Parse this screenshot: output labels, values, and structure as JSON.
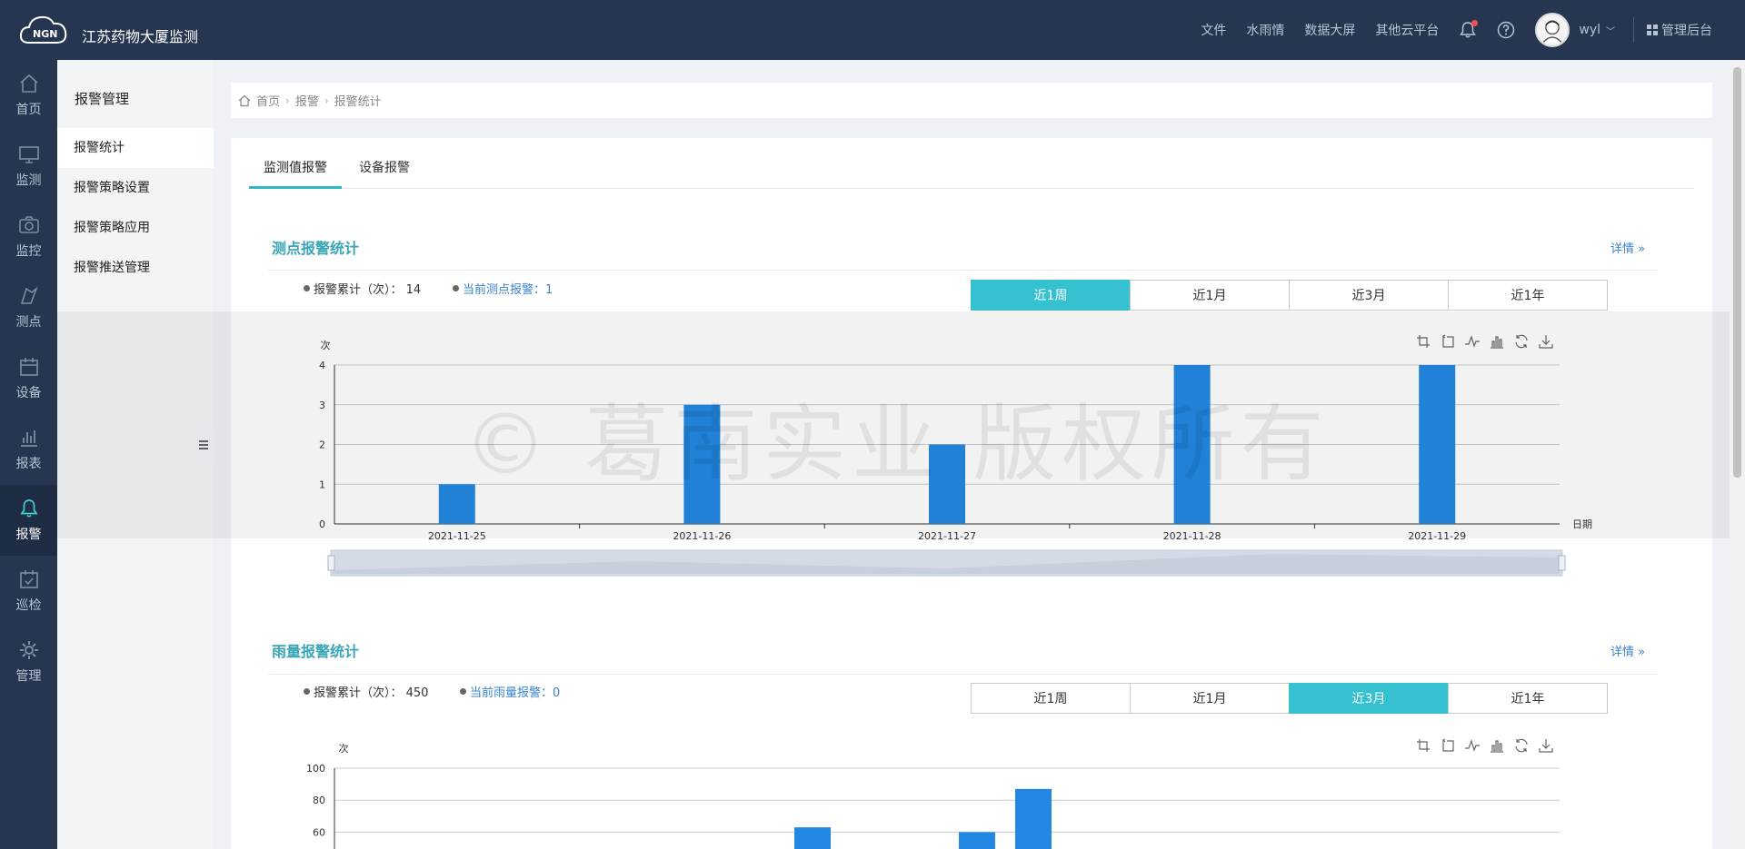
{
  "app": {
    "logo_text": "NGN",
    "title": "江苏药物大厦监测"
  },
  "topnav": {
    "links": [
      "文件",
      "水雨情",
      "数据大屏",
      "其他云平台"
    ],
    "user": "wyl",
    "admin_label": "管理后台"
  },
  "sidenav": {
    "items": [
      {
        "label": "首页",
        "icon": "home-icon"
      },
      {
        "label": "监测",
        "icon": "monitor-icon"
      },
      {
        "label": "监控",
        "icon": "camera-icon"
      },
      {
        "label": "测点",
        "icon": "point-icon"
      },
      {
        "label": "设备",
        "icon": "device-icon"
      },
      {
        "label": "报表",
        "icon": "report-icon"
      },
      {
        "label": "报警",
        "icon": "bell-icon",
        "active": true
      },
      {
        "label": "巡检",
        "icon": "inspection-icon"
      },
      {
        "label": "管理",
        "icon": "gear-icon"
      }
    ]
  },
  "submenu": {
    "title": "报警管理",
    "items": [
      "报警统计",
      "报警策略设置",
      "报警策略应用",
      "报警推送管理"
    ]
  },
  "breadcrumb": [
    "首页",
    "报警",
    "报警统计"
  ],
  "tabs": [
    "监测值报警",
    "设备报警"
  ],
  "section1": {
    "title": "测点报警统计",
    "detail": "详情 »",
    "stat_total": "报警累计（次）： 14",
    "stat_current": "当前测点报警：1",
    "ranges": [
      "近1周",
      "近1月",
      "近3月",
      "近1年"
    ],
    "active_range": 0
  },
  "section2": {
    "title": "雨量报警统计",
    "detail": "详情 »",
    "stat_total": "报警累计（次）： 450",
    "stat_current": "当前雨量报警：0",
    "ranges": [
      "近1周",
      "近1月",
      "近3月",
      "近1年"
    ],
    "active_range": 2
  },
  "watermark": "© 葛南实业 版权所有",
  "colors": {
    "header": "#263650",
    "accent": "#36c1d1",
    "bar": "#2288e3",
    "title": "#3aa6b5"
  },
  "chart_data": [
    {
      "type": "bar",
      "categories": [
        "2021-11-25",
        "2021-11-26",
        "2021-11-27",
        "2021-11-28",
        "2021-11-29"
      ],
      "values": [
        1,
        3,
        2,
        4,
        4
      ],
      "ylabel": "次",
      "xlabel": "日期",
      "ylim": [
        0,
        4
      ],
      "yticks": [
        0,
        1,
        2,
        3,
        4
      ],
      "grid": true
    },
    {
      "type": "bar",
      "values_visible": [
        63,
        60,
        87
      ],
      "ylabel": "次",
      "ylim": [
        0,
        100
      ],
      "yticks_visible": [
        60,
        80,
        100
      ],
      "grid": true
    }
  ]
}
